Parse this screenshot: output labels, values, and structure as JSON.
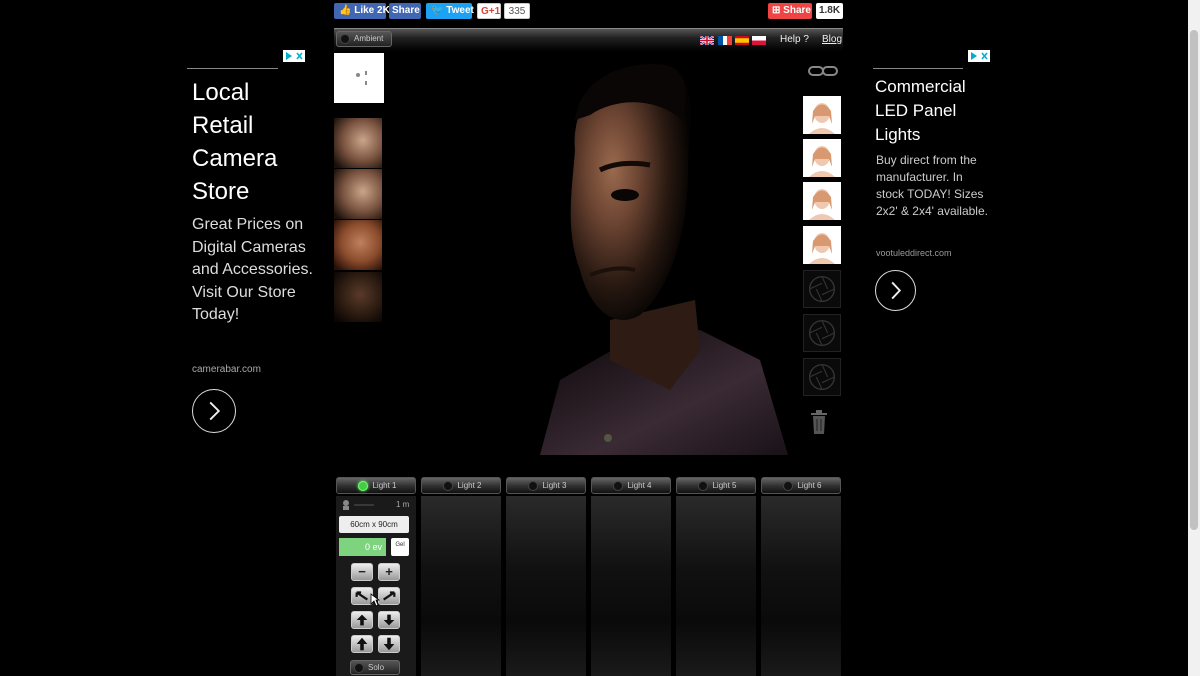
{
  "social": {
    "fb_like": "Like 2K",
    "fb_share": "Share",
    "tweet": "Tweet",
    "gplus": "G+1",
    "gplus_count": "335",
    "share": "Share",
    "share_count": "1.8K"
  },
  "topbar": {
    "ambient_label": "Ambient",
    "help": "Help ?",
    "blog": "Blog",
    "flags": [
      "english-flag-icon",
      "french-flag-icon",
      "spanish-flag-icon",
      "polish-flag-icon"
    ]
  },
  "ad_left": {
    "title": "Local Retail Camera Store",
    "body": "Great Prices on Digital Cameras and Accessories. Visit Our Store Today!",
    "url": "camerabar.com"
  },
  "ad_right": {
    "title": "Commercial LED Panel Lights",
    "body": "Buy direct from the manufacturer. In stock TODAY! Sizes 2x2' & 2x4' available.",
    "url": "vootuleddirect.com"
  },
  "lights": {
    "tabs": [
      "Light 1",
      "Light 2",
      "Light 3",
      "Light 4",
      "Light 5",
      "Light 6"
    ],
    "distance": "1 m",
    "size": "60cm x 90cm",
    "ev": "0 ev",
    "gel": "Gel",
    "solo": "Solo",
    "minus": "−",
    "plus": "+"
  },
  "colors": {
    "accent_green": "#7ed37e",
    "facebook": "#4267b2",
    "twitter": "#1da1f2",
    "share_red": "#e44444"
  }
}
